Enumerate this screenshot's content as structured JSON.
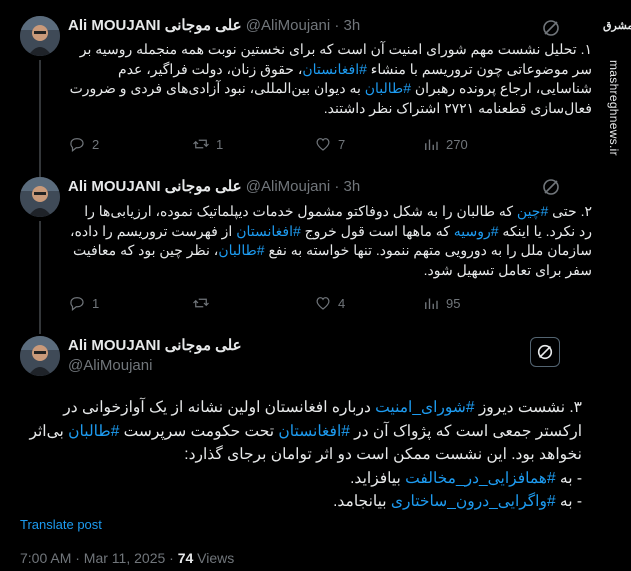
{
  "tweets": [
    {
      "name": "Ali MOUJANI علی موجانی",
      "handle": "@AliMoujani",
      "time": "3h",
      "text_html": "۱. تحلیل نشست مهم شورای امنیت آن است که برای نخستین نوبت همه منجمله روسیه بر سر موضوعاتی چون تروریسم با منشاء <span class=\"ht\">#افغانستان</span>، حقوق زنان، دولت فراگیر، عدم شناسایی، ارجاع پرونده رهبران <span class=\"ht\">#طالبان</span> به دیوان بین‌المللی، نبود آزادی‌های فردی و ضرورت فعال‌سازی قطعنامه ۲۷۲۱ اشتراک نظر داشتند.",
      "replies": "2",
      "retweets": "1",
      "likes": "7",
      "views": "270"
    },
    {
      "name": "Ali MOUJANI علی موجانی",
      "handle": "@AliMoujani",
      "time": "3h",
      "text_html": "۲. حتی <span class=\"ht\">#چین</span> که طالبان را به شکل دوفاکتو  مشمول خدمات دیپلماتیک نموده، ارزیابی‌ها را رد نکرد. یا اینکه <span class=\"ht\">#روسیه</span> که ماهها است قول خروج <span class=\"ht\">#افغانستان</span> از فهرست تروریسم را داده، سازمان ملل را به دورویی متهم ننمود. تنها خواسته به نفع <span class=\"ht\">#طالبان</span>، نظر چین بود که معافیت سفر برای تعامل تسهیل شود.",
      "replies": "1",
      "retweets": "",
      "likes": "4",
      "views": "95"
    }
  ],
  "main": {
    "name": "Ali MOUJANI علی موجانی",
    "handle": "@AliMoujani",
    "text_html": "۳. نشست دیروز <span class=\"ht\">#شورای_امنیت</span> درباره افغانستان اولین نشانه از یک آوازخوانی در ارکستر جمعی است که پژواک آن در <span class=\"ht\">#افغانستان</span> تحت حکومت سرپرست <span class=\"ht\">#طالبان</span> بی‌اثر نخواهد بود. این نشست ممکن است دو اثر توامان برجای گذارد:<br>- به <span class=\"ht\">#همافزایی_در_مخالفت</span> بیافزاید.<br>- به <span class=\"ht\">#واگرایی_درون_ساختاری</span> بیانجامد.",
    "translate": "Translate post",
    "datetime": "7:00 AM · Mar 11, 2025 · ",
    "views_count": "74",
    "views_label": " Views"
  },
  "watermark": {
    "logo": "مشرق",
    "url": "mashreghnews.ir"
  },
  "colors": {
    "background": "#000000",
    "text": "#e7e9ea",
    "muted": "#71767b",
    "link": "#1d9bf0",
    "divider": "#2f3336"
  }
}
